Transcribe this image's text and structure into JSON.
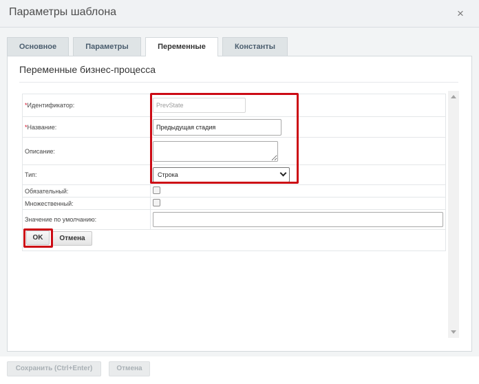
{
  "dialog": {
    "title": "Параметры шаблона",
    "close_glyph": "×"
  },
  "tabs": [
    {
      "label": "Основное",
      "active": false
    },
    {
      "label": "Параметры",
      "active": false
    },
    {
      "label": "Переменные",
      "active": true
    },
    {
      "label": "Константы",
      "active": false
    }
  ],
  "section": {
    "title": "Переменные бизнес-процесса"
  },
  "form": {
    "required_mark": "*",
    "identifier": {
      "label": "Идентификатор:",
      "value": "PrevState"
    },
    "name": {
      "label": "Название:",
      "value": "Предыдущая стадия"
    },
    "description": {
      "label": "Описание:",
      "value": ""
    },
    "type": {
      "label": "Тип:",
      "selected": "Строка"
    },
    "required": {
      "label": "Обязательный:",
      "checked": false
    },
    "multiple": {
      "label": "Множественный:",
      "checked": false
    },
    "default_value": {
      "label": "Значение по умолчанию:",
      "value": ""
    },
    "ok_label": "OK",
    "cancel_label": "Отмена"
  },
  "footer": {
    "save_label": "Сохранить (Ctrl+Enter)",
    "cancel_label": "Отмена"
  },
  "colors": {
    "highlight": "#cc0a14",
    "required": "#d0021b"
  },
  "icons": {
    "close": "close-icon",
    "scroll_up": "arrow-up-icon",
    "scroll_down": "arrow-down-icon",
    "select": "chevron-down-icon"
  }
}
